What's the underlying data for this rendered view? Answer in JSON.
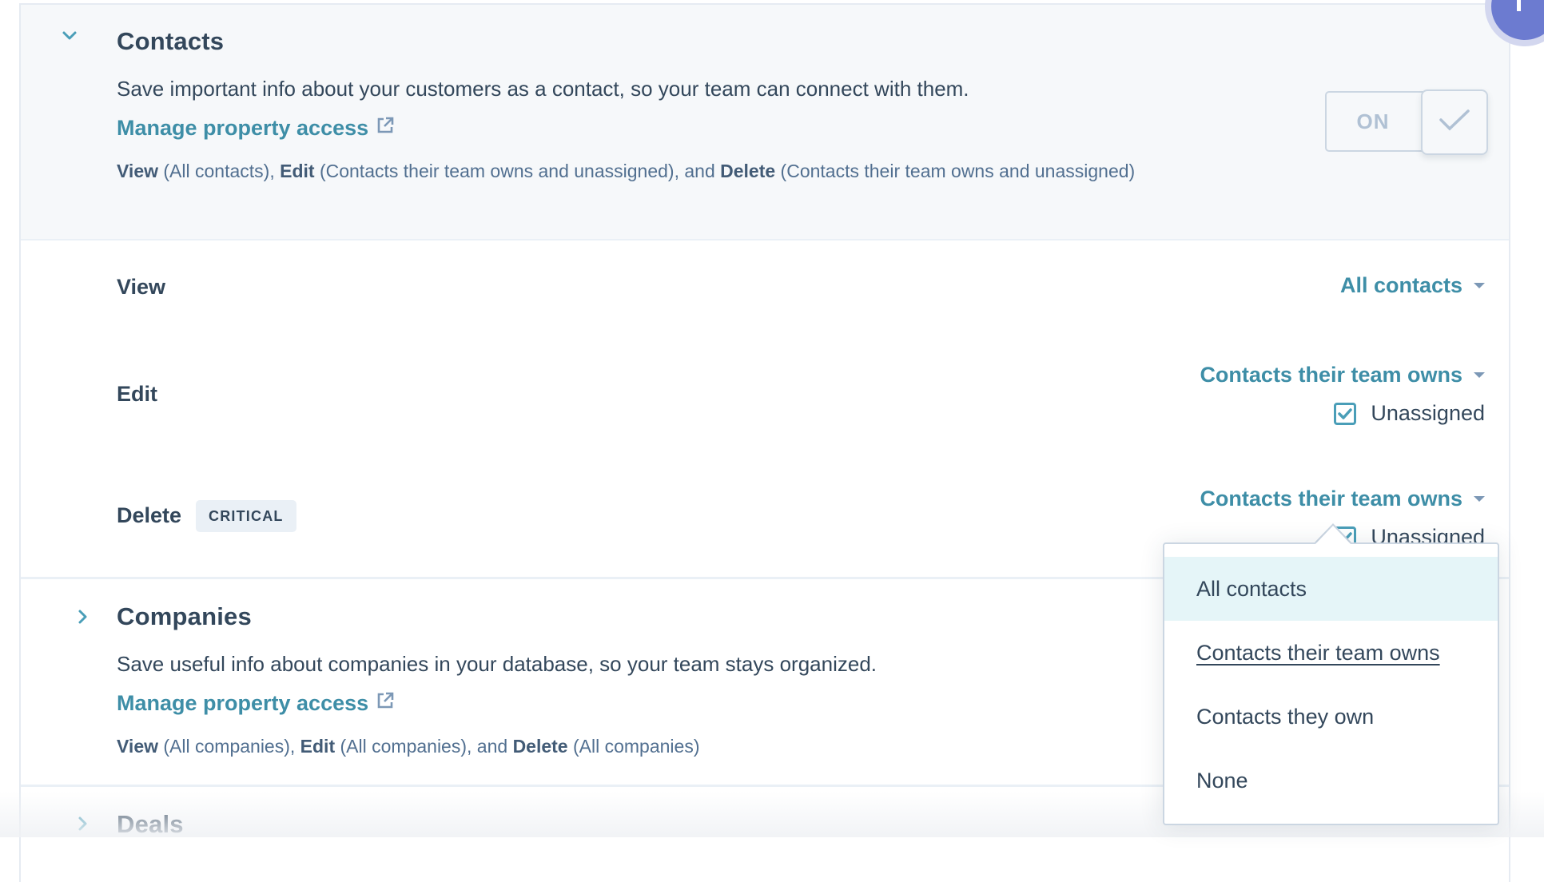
{
  "sections": {
    "contacts": {
      "title": "Contacts",
      "expanded": true,
      "description": "Save important info about your customers as a contact, so your team can connect with them.",
      "manage_link": "Manage property access",
      "summary": {
        "view_label": "View",
        "view_value": " (All contacts), ",
        "edit_label": "Edit",
        "edit_value": " (Contacts their team owns and unassigned), and ",
        "delete_label": "Delete",
        "delete_value": " (Contacts their team owns and unassigned)"
      },
      "toggle": {
        "label": "ON",
        "state": "on"
      },
      "permissions": {
        "view": {
          "label": "View",
          "selected": "All contacts"
        },
        "edit": {
          "label": "Edit",
          "selected": "Contacts their team owns",
          "unassigned_label": "Unassigned",
          "unassigned_checked": true
        },
        "delete": {
          "label": "Delete",
          "badge": "CRITICAL",
          "selected": "Contacts their team owns",
          "unassigned_label": "Unassigned",
          "unassigned_checked": true
        }
      }
    },
    "companies": {
      "title": "Companies",
      "expanded": false,
      "description": "Save useful info about companies in your database, so your team stays organized.",
      "manage_link": "Manage property access",
      "summary": {
        "view_label": "View",
        "view_value": " (All companies), ",
        "edit_label": "Edit",
        "edit_value": " (All companies), and ",
        "delete_label": "Delete",
        "delete_value": " (All companies)"
      }
    },
    "deals": {
      "title": "Deals",
      "expanded": false
    }
  },
  "dropdown": {
    "options": [
      {
        "label": "All contacts",
        "state": "highlighted"
      },
      {
        "label": "Contacts their team owns",
        "state": "hover"
      },
      {
        "label": "Contacts they own",
        "state": "normal"
      },
      {
        "label": "None",
        "state": "normal"
      }
    ]
  },
  "colors": {
    "accent": "#3e8ea7",
    "text": "#33475b",
    "muted": "#516f90",
    "header_bg": "#f6f8fa",
    "highlight_bg": "#e5f5f8",
    "avatar": "#6c7bd0"
  }
}
